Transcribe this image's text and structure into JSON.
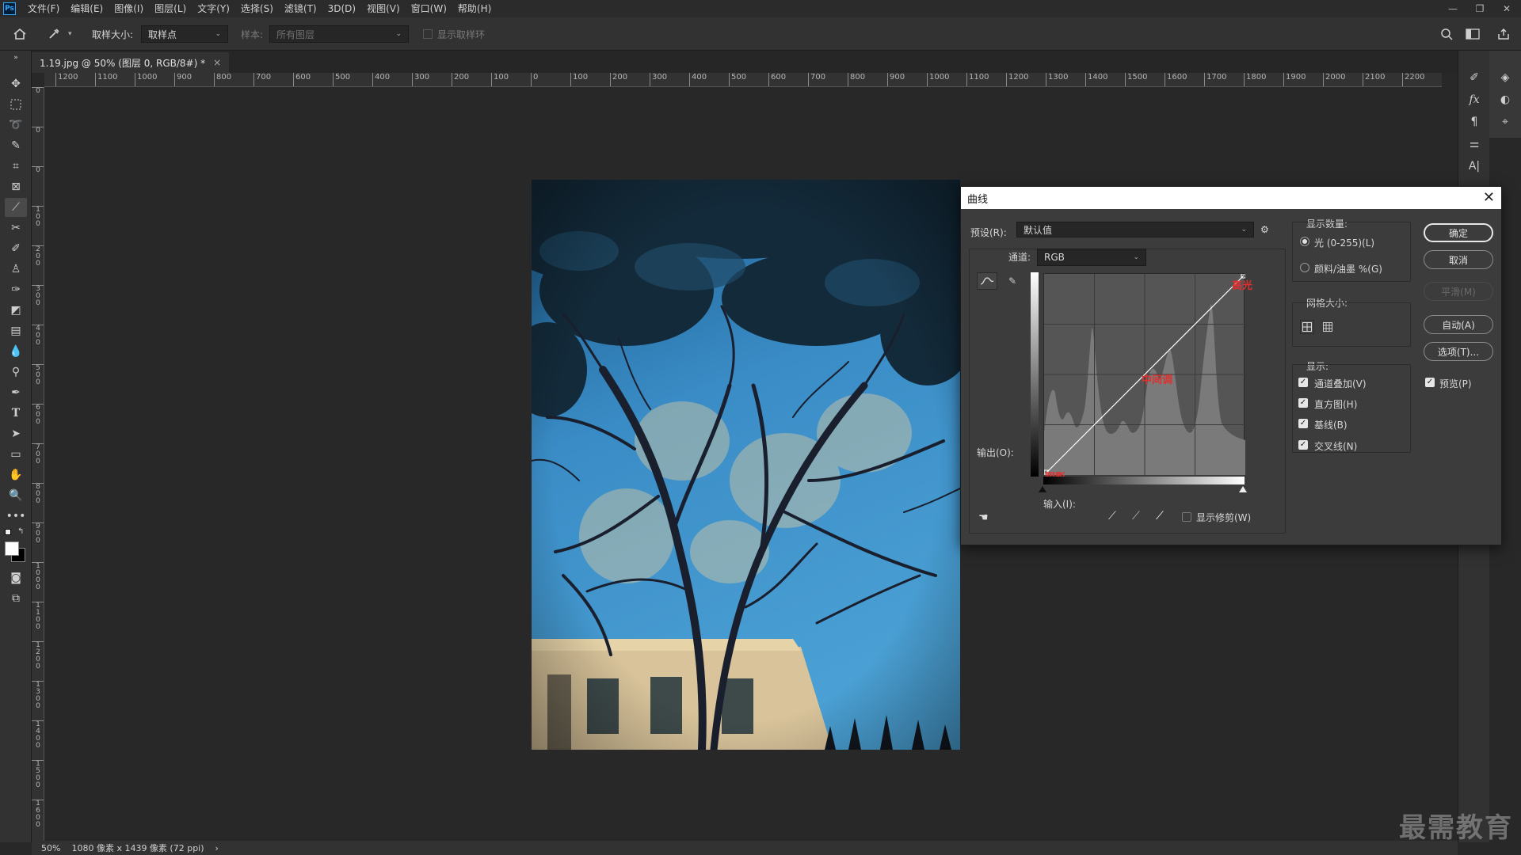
{
  "menu": {
    "logo": "Ps",
    "items": [
      "文件(F)",
      "编辑(E)",
      "图像(I)",
      "图层(L)",
      "文字(Y)",
      "选择(S)",
      "滤镜(T)",
      "3D(D)",
      "视图(V)",
      "窗口(W)",
      "帮助(H)"
    ],
    "win_minimize": "—",
    "win_restore": "❐",
    "win_close": "✕"
  },
  "options": {
    "sample_size_label": "取样大小:",
    "sample_size_value": "取样点",
    "sample_label": "样本:",
    "sample_value": "所有图层",
    "show_ring_label": "显示取样环"
  },
  "document": {
    "tab_title": "1.19.jpg @ 50% (图层 0, RGB/8#) *",
    "tab_close": "×"
  },
  "ruler": {
    "h_ticks": [
      "1200",
      "1100",
      "1000",
      "900",
      "800",
      "700",
      "600",
      "500",
      "400",
      "300",
      "200",
      "100",
      "0",
      "100",
      "200",
      "300",
      "400",
      "500",
      "600",
      "700",
      "800",
      "900",
      "1000",
      "1100",
      "1200",
      "1300",
      "1400",
      "1500",
      "1600",
      "1700",
      "1800",
      "1900",
      "2000",
      "2100",
      "2200"
    ],
    "v_ticks": [
      "0",
      "0",
      "0",
      "1\n0\n0",
      "2\n0\n0",
      "3\n0\n0",
      "4\n0\n0",
      "5\n0\n0",
      "6\n0\n0",
      "7\n0\n0",
      "8\n0\n0",
      "9\n0\n0",
      "1\n0\n0\n0",
      "1\n1\n0\n0",
      "1\n2\n0\n0",
      "1\n3\n0\n0",
      "1\n4\n0\n0",
      "1\n5\n0\n0",
      "1\n6\n0\n0"
    ]
  },
  "status": {
    "zoom": "50%",
    "doc_info": "1080 像素 x 1439 像素 (72 ppi)",
    "arrow": "›"
  },
  "watermark": "最需教育",
  "curves": {
    "title": "曲线",
    "close": "✕",
    "preset_label": "预设(R):",
    "preset_value": "默认值",
    "channel_label": "通道:",
    "channel_value": "RGB",
    "output_label": "输出(O):",
    "input_label": "输入(I):",
    "show_clipping_label": "显示修剪(W)",
    "annotations": {
      "highlight": "高光",
      "midtone": "中间调",
      "shadow": "阴影"
    },
    "display_amount": {
      "title": "显示数量:",
      "light": "光 (0-255)(L)",
      "pigment": "颜料/油墨 %(G)"
    },
    "grid_size": {
      "title": "网格大小:"
    },
    "show": {
      "title": "显示:",
      "channel_overlay": "通道叠加(V)",
      "histogram": "直方图(H)",
      "baseline": "基线(B)",
      "intersection": "交叉线(N)"
    },
    "buttons": {
      "ok": "确定",
      "cancel": "取消",
      "smooth": "平滑(M)",
      "auto": "自动(A)",
      "options": "选项(T)...",
      "preview": "预览(P)"
    }
  }
}
